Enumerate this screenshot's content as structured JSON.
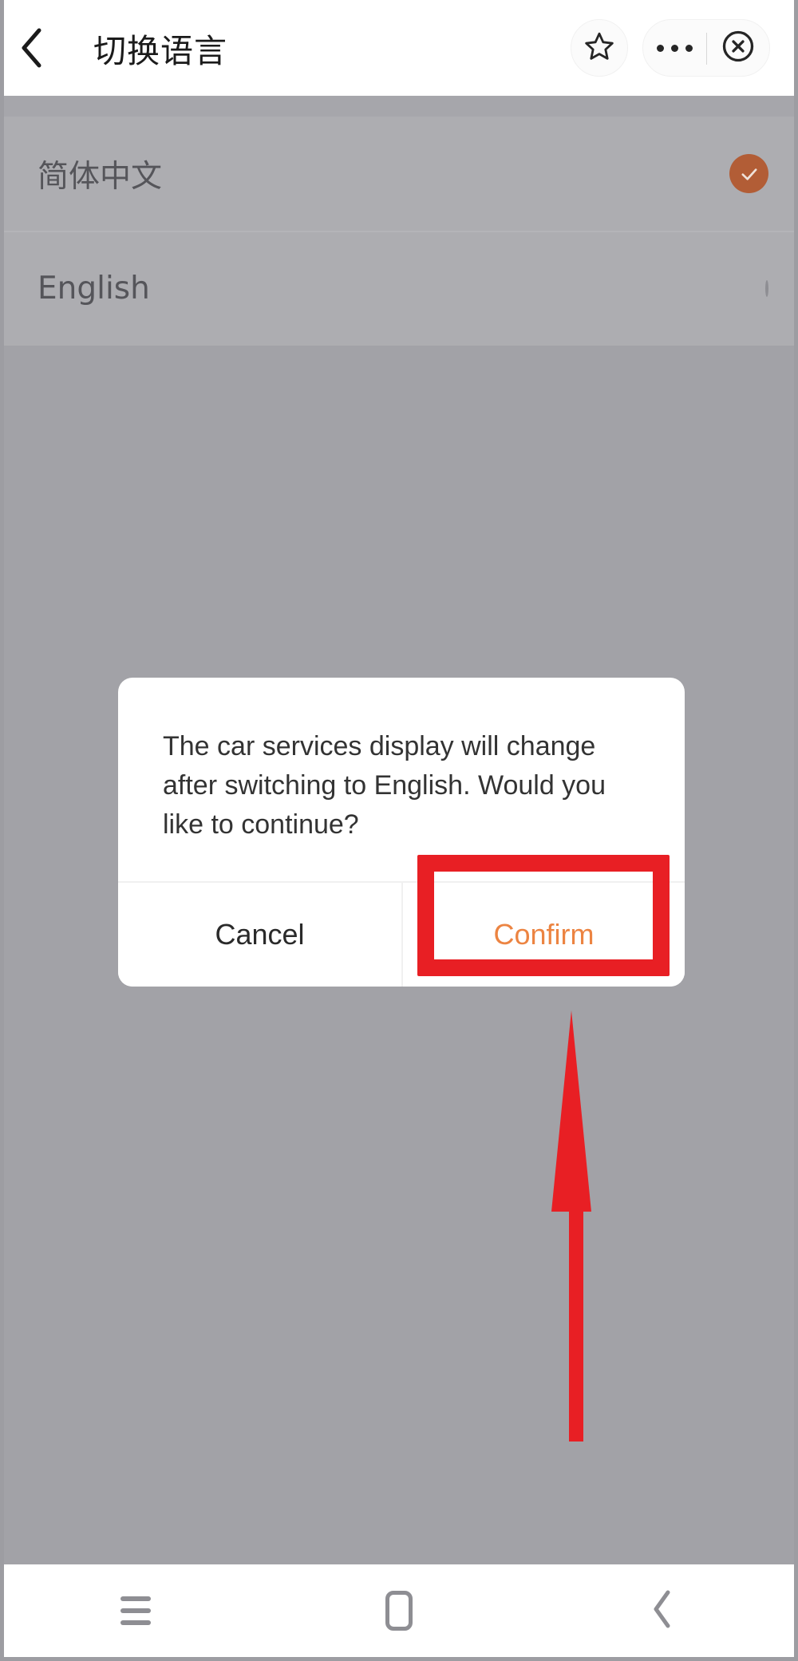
{
  "header": {
    "back_icon": "back-chevron-icon",
    "title": "切换语言",
    "star_icon": "star-outline-icon",
    "more_icon": "more-dots-icon",
    "close_icon": "close-circle-icon"
  },
  "language_list": {
    "items": [
      {
        "label": "简体中文",
        "selected": true,
        "mark_icon": "check-circle-icon"
      },
      {
        "label": "English",
        "selected": false,
        "mark_icon": "radio-empty-icon"
      }
    ]
  },
  "dialog": {
    "message": "The car services display will change after switching to English. Would you like to continue?",
    "cancel_label": "Cancel",
    "confirm_label": "Confirm"
  },
  "annotations": {
    "highlight_box_target": "Confirm",
    "highlight_color": "#E81F24",
    "arrow_icon": "up-arrow-annotation",
    "arrow_color": "#E81F24"
  },
  "bottom_nav": {
    "recents_icon": "recents-menu-icon",
    "home_icon": "home-square-icon",
    "back_icon": "back-chevron-icon"
  },
  "colors": {
    "accent_orange": "#EC8442",
    "selected_check": "#B25D36",
    "dim_overlay": "#A2A2A7",
    "annotation_red": "#E81F24",
    "dialog_bg": "#FFFFFF"
  }
}
